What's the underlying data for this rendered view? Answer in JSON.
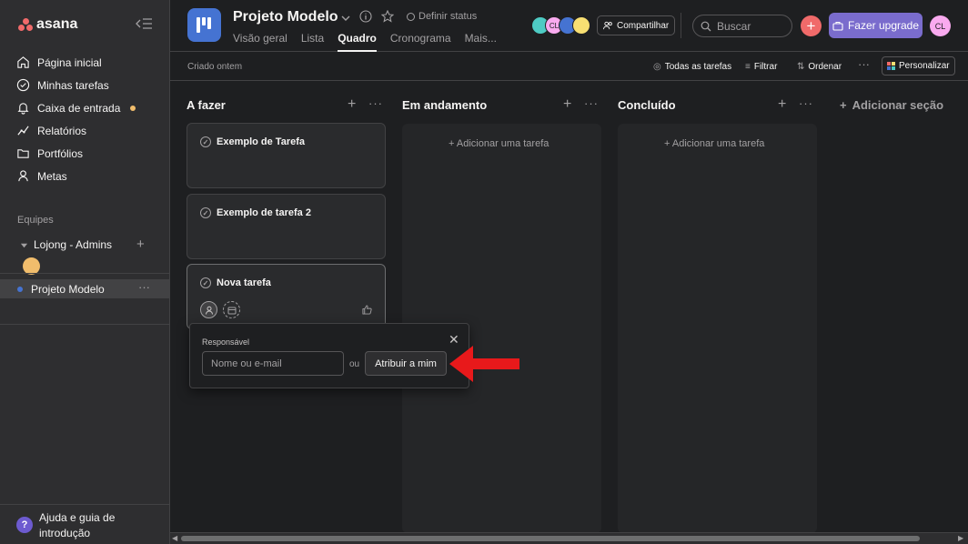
{
  "sidebar": {
    "logo_text": "asana",
    "nav": [
      {
        "label": "Página inicial",
        "icon": "home-icon"
      },
      {
        "label": "Minhas tarefas",
        "icon": "check-circle-icon"
      },
      {
        "label": "Caixa de entrada",
        "icon": "bell-icon"
      },
      {
        "label": "Relatórios",
        "icon": "chart-line-icon"
      },
      {
        "label": "Portfólios",
        "icon": "folder-icon"
      },
      {
        "label": "Metas",
        "icon": "person-icon"
      }
    ],
    "teams_label": "Equipes",
    "team_name": "Lojong - Admins",
    "project_name": "Projeto Modelo",
    "help_line1": "Ajuda e guia de",
    "help_line2": "introdução"
  },
  "header": {
    "project_title": "Projeto Modelo",
    "status_label": "Definir status",
    "tabs": [
      "Visão geral",
      "Lista",
      "Quadro",
      "Cronograma",
      "Mais..."
    ],
    "active_tab": "Quadro",
    "members": [
      {
        "initials": "",
        "color": "#4ecbc4"
      },
      {
        "initials": "CL",
        "color": "#f9aaef"
      },
      {
        "initials": "",
        "color": "#4573d2"
      },
      {
        "initials": "",
        "color": "#f8df72"
      }
    ],
    "share_label": "Compartilhar",
    "search_placeholder": "Buscar",
    "upgrade_label": "Fazer upgrade",
    "user_initials": "CL"
  },
  "toolbar": {
    "created": "Criado ontem",
    "all_tasks": "Todas as tarefas",
    "filter": "Filtrar",
    "sort": "Ordenar",
    "personalize": "Personalizar"
  },
  "board": {
    "columns": [
      {
        "title": "A fazer"
      },
      {
        "title": "Em andamento",
        "add_task": "+ Adicionar uma tarefa"
      },
      {
        "title": "Concluído",
        "add_task": "+ Adicionar uma tarefa"
      }
    ],
    "add_section": "Adicionar seção",
    "cards": [
      {
        "title": "Exemplo de Tarefa"
      },
      {
        "title": "Exemplo de tarefa 2"
      },
      {
        "title": "Nova tarefa"
      }
    ]
  },
  "assignee_popover": {
    "label": "Responsável",
    "input_placeholder": "Nome ou e-mail",
    "or_text": "ou",
    "assign_me": "Atribuir a mim"
  },
  "colors": {
    "accent_red": "#f06a6a",
    "upgrade_purple": "#7a6ccd",
    "annotation_arrow": "#e8191b"
  }
}
